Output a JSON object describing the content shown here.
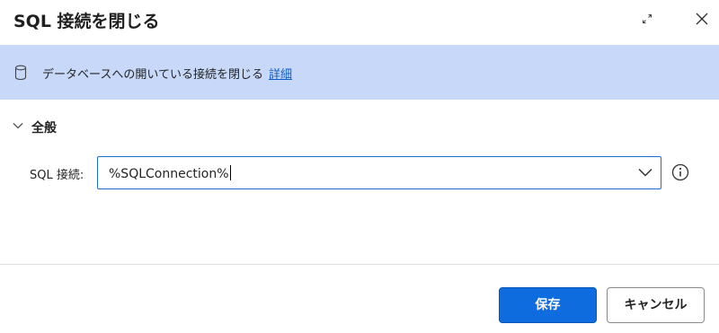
{
  "dialog": {
    "title": "SQL 接続を閉じる"
  },
  "banner": {
    "icon": "database-icon",
    "text": "データベースへの開いている接続を閉じる",
    "link_label": "詳細"
  },
  "section": {
    "title": "全般",
    "expanded": true
  },
  "fields": {
    "sql_connection": {
      "label": "SQL 接続:",
      "value": "%SQLConnection%"
    }
  },
  "footer": {
    "save_label": "保存",
    "cancel_label": "キャンセル"
  },
  "colors": {
    "banner_bg": "#c7d8f8",
    "primary": "#0f6cde",
    "link": "#0f5dc9"
  }
}
